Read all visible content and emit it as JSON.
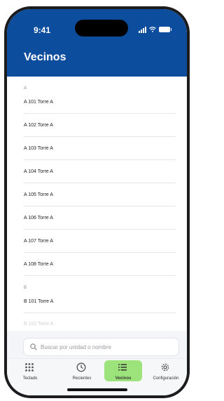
{
  "status": {
    "time": "9:41"
  },
  "header": {
    "title": "Vecinos"
  },
  "sections": [
    {
      "letter": "A",
      "items": [
        "A 101 Torre A",
        "A 102 Torre A",
        "A 103 Torre A",
        "A 104 Torre A",
        "A 105 Torre A",
        "A 106 Torre A",
        "A 107 Torre A",
        "A 108 Torre A"
      ]
    },
    {
      "letter": "B",
      "items": [
        "B 101 Torre A",
        "B 102 Torre A"
      ]
    }
  ],
  "search": {
    "placeholder": "Buscar por unidad o nombre"
  },
  "tabbar": {
    "active": "Vecinos",
    "items": [
      {
        "label": "Teclado",
        "icon": "keypad-icon"
      },
      {
        "label": "Recientes",
        "icon": "clock-icon"
      },
      {
        "label": "Vecinos",
        "icon": "list-icon"
      },
      {
        "label": "Configuración",
        "icon": "gear-icon"
      }
    ]
  },
  "colors": {
    "header": "#0d4d9e",
    "active_tab": "#9be37a"
  }
}
